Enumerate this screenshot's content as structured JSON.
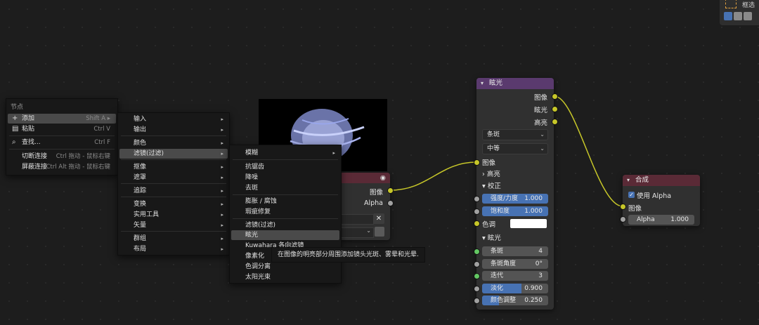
{
  "select_tool": {
    "label": "框选"
  },
  "menu_main": {
    "title": "节点",
    "items": [
      {
        "icon": "+",
        "label": "添加",
        "shortcut": "Shift A ▸"
      },
      {
        "icon": "▤",
        "label": "粘贴",
        "shortcut": "Ctrl V"
      },
      {
        "icon": "⌕",
        "label": "查找...",
        "shortcut": "Ctrl F"
      },
      {
        "label": "切断连接",
        "shortcut": "Ctrl 拖动 - 鼠标右键"
      },
      {
        "label": "屏蔽连接",
        "shortcut": "Ctrl Alt 拖动 - 鼠标右键"
      }
    ]
  },
  "menu_add": {
    "items": [
      "输入",
      "输出",
      "颜色",
      "滤镜(过滤)",
      "抠像",
      "遮罩",
      "追踪",
      "变换",
      "实用工具",
      "矢量",
      "群组",
      "布局"
    ],
    "arrow": "▸"
  },
  "menu_filter": {
    "items": [
      "模糊",
      "抗锯齿",
      "降噪",
      "去斑",
      "膨胀 / 腐蚀",
      "瑕疵修复",
      "滤镜(过滤)",
      "眩光",
      "Kuwahara 各向滤镜",
      "像素化",
      "色调分离",
      "太阳光束"
    ],
    "arrow": "▸"
  },
  "tooltip": "在图像的明亮部分周围添加镜头光斑、雾晕和光晕.",
  "image_node": {
    "outputs": [
      "图像",
      "Alpha"
    ],
    "close": "✕"
  },
  "glare_node": {
    "title": "眩光",
    "outputs": [
      "图像",
      "眩光",
      "高亮"
    ],
    "type_value": "条斑",
    "quality_value": "中等",
    "input_image": "图像",
    "highlights_label": "高亮",
    "adjust_label": "校正",
    "strength": {
      "label": "强度/力度",
      "value": "1.000"
    },
    "saturation": {
      "label": "饱和度",
      "value": "1.000"
    },
    "tint_label": "色调",
    "glare_section": "眩光",
    "streaks": {
      "label": "条斑",
      "value": "4"
    },
    "streak_angle": {
      "label": "条斑角度",
      "value": "0°"
    },
    "iterations": {
      "label": "迭代",
      "value": "3"
    },
    "fade": {
      "label": "淡化",
      "value": "0.900",
      "fraction": 0.6
    },
    "color_mod": {
      "label": "颜色调整",
      "value": "0.250",
      "fraction": 0.25
    }
  },
  "composite_node": {
    "title": "合成",
    "use_alpha": "使用 Alpha",
    "input_image": "图像",
    "alpha": {
      "label": "Alpha",
      "value": "1.000"
    }
  },
  "colors": {
    "filter_header": "#5a3a6e",
    "output_header": "#5a2a36",
    "link": "#c7c729",
    "accent": "#4772b3"
  }
}
